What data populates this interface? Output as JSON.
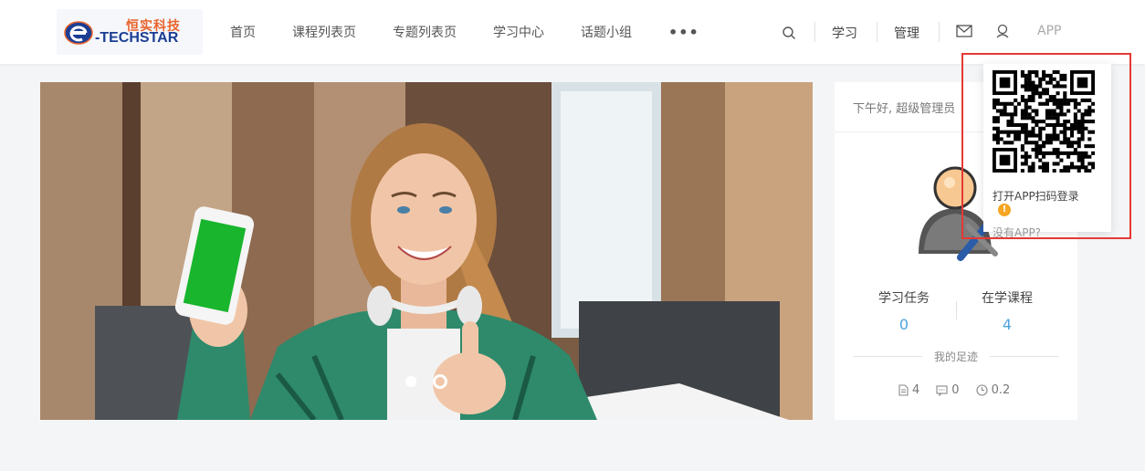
{
  "brand": {
    "name_cn": "恒实科技",
    "name_en": "-TECHSTAR",
    "colors": {
      "primary": "#1b3e94",
      "accent": "#e8642c"
    }
  },
  "nav": {
    "items": [
      {
        "label": "首页"
      },
      {
        "label": "课程列表页"
      },
      {
        "label": "专题列表页"
      },
      {
        "label": "学习中心"
      },
      {
        "label": "话题小组"
      }
    ],
    "more": "•••"
  },
  "toolbar": {
    "search_icon": "search-icon",
    "study": "学习",
    "manage": "管理",
    "mail_icon": "mail-icon",
    "user_icon": "user-icon",
    "app": "APP"
  },
  "carousel": {
    "slide_count": 2,
    "active_index": 1
  },
  "user_card": {
    "greeting": "下午好, 超级管理员",
    "stats": [
      {
        "label": "学习任务",
        "value": "0"
      },
      {
        "label": "在学课程",
        "value": "4"
      }
    ],
    "footprint_title": "我的足迹",
    "footprint": [
      {
        "icon": "document-icon",
        "value": "4"
      },
      {
        "icon": "comment-icon",
        "value": "0"
      },
      {
        "icon": "clock-icon",
        "value": "0.2"
      }
    ],
    "stat_color": "#4aa3df"
  },
  "app_popup": {
    "qr_icon": "qr-code",
    "scan_text": "打开APP扫码登录",
    "no_app_link": "没有APP?",
    "highlight_color": "#e53935"
  }
}
